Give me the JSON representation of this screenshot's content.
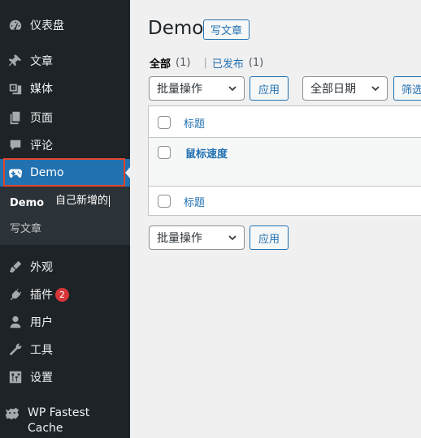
{
  "sidebar": {
    "dashboard": "仪表盘",
    "posts": "文章",
    "media": "媒体",
    "pages": "页面",
    "comments": "评论",
    "demo": "Demo",
    "demo_sub_current": "Demo",
    "demo_sub_new": "写文章",
    "annotation": "自己新增的",
    "appearance": "外观",
    "plugins": "插件",
    "plugins_badge": "2",
    "users": "用户",
    "tools": "工具",
    "settings": "设置",
    "wpfc_line1": "WP Fastest",
    "wpfc_line2": "Cache"
  },
  "main": {
    "title": "Demo",
    "add_new": "写文章",
    "filters": {
      "all": "全部",
      "all_count": "(1)",
      "sep": "|",
      "published": "已发布",
      "published_count": "(1)"
    },
    "bulk_select": "批量操作",
    "apply": "应用",
    "date_select": "全部日期",
    "filter_btn": "筛选",
    "table": {
      "header": "标题",
      "footer": "标题",
      "rows": [
        {
          "title": "鼠标速度"
        }
      ]
    },
    "bottom_bulk_select": "批量操作",
    "bottom_apply": "应用"
  },
  "colors": {
    "sidebar_bg": "#1d2327",
    "active_bg": "#2271b1",
    "link": "#2271b1",
    "badge": "#d63638",
    "annotation_border": "#e0452c"
  }
}
